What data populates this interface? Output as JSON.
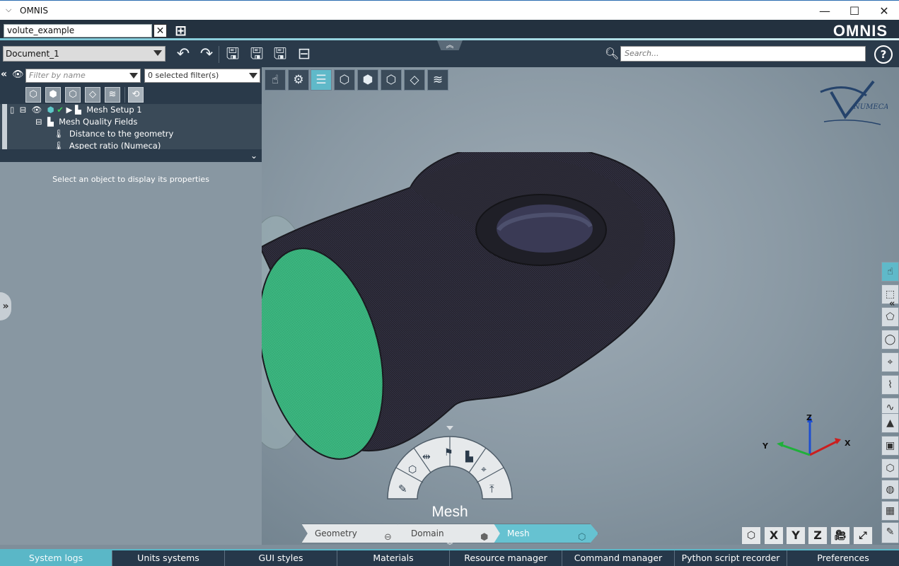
{
  "window": {
    "title": "OMNIS",
    "minimize_icon": "minimize-icon",
    "maximize_icon": "maximize-icon",
    "close_icon": "close-icon"
  },
  "project": {
    "name": "volute_example",
    "logo_text": "OMNIS"
  },
  "toolbar": {
    "document": "Document_1",
    "search_placeholder": "Search...",
    "help_label": "?"
  },
  "tree_panel": {
    "filter_placeholder": "Filter by name",
    "selected_filters": "0 selected filter(s)",
    "items": [
      {
        "label": "Mesh Setup 1"
      },
      {
        "label": "Mesh Quality Fields"
      },
      {
        "label": "Distance to the geometry"
      },
      {
        "label": "Aspect ratio (Numeca)"
      }
    ]
  },
  "properties": {
    "message": "Select an object to display its properties"
  },
  "viewport": {
    "watermark": "NUMECA",
    "axes": {
      "x": "X",
      "y": "Y",
      "z": "Z"
    },
    "colors": {
      "mesh_body": "#24232b",
      "inlet_face": "#3fbf86",
      "axis_x": "#cc1e1e",
      "axis_y": "#1fb03a",
      "axis_z": "#1e4fd0"
    }
  },
  "mesh_menu": {
    "title": "Mesh"
  },
  "workflow": {
    "steps": [
      {
        "label": "Geometry"
      },
      {
        "label": "Domain"
      },
      {
        "label": "Mesh"
      }
    ]
  },
  "view_buttons": {
    "x": "X",
    "y": "Y",
    "z": "Z"
  },
  "bottom_tabs": [
    {
      "label": "System logs"
    },
    {
      "label": "Units systems"
    },
    {
      "label": "GUI styles"
    },
    {
      "label": "Materials"
    },
    {
      "label": "Resource manager"
    },
    {
      "label": "Command manager"
    },
    {
      "label": "Python script recorder"
    },
    {
      "label": "Preferences"
    }
  ],
  "theme": {
    "accent": "#5ab7c7",
    "dark_panel": "#2a3a4a"
  }
}
